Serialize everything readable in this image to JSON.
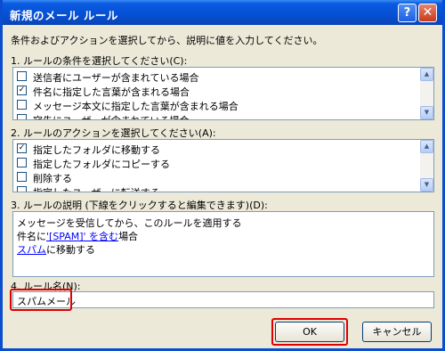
{
  "window": {
    "title": "新規のメール ルール",
    "help_icon": "?",
    "close_icon": "✕"
  },
  "instructions": "条件およびアクションを選択してから、説明に値を入力してください。",
  "step1": {
    "label": "1. ルールの条件を選択してください(C):",
    "items": [
      {
        "text": "送信者にユーザーが含まれている場合",
        "checked": false
      },
      {
        "text": "件名に指定した言葉が含まれる場合",
        "checked": true
      },
      {
        "text": "メッセージ本文に指定した言葉が含まれる場合",
        "checked": false
      },
      {
        "text": "宛先にユーザーが含まれている場合",
        "checked": false
      }
    ]
  },
  "step2": {
    "label": "2. ルールのアクションを選択してください(A):",
    "items": [
      {
        "text": "指定したフォルダに移動する",
        "checked": true
      },
      {
        "text": "指定したフォルダにコピーする",
        "checked": false
      },
      {
        "text": "削除する",
        "checked": false
      },
      {
        "text": "指定したユーザーに転送する",
        "checked": false
      }
    ]
  },
  "step3": {
    "label": "3. ルールの説明 (下線をクリックすると編集できます)(D):",
    "line1": "メッセージを受信してから、このルールを適用する",
    "line2_prefix": "件名に",
    "line2_link1": "'[SPAM]' を含む",
    "line2_suffix": "場合",
    "line3_link": "スパム",
    "line3_suffix": "に移動する"
  },
  "step4": {
    "label": "4. ルール名(N):",
    "value": "スパムメール"
  },
  "buttons": {
    "ok": "OK",
    "cancel": "キャンセル"
  },
  "check_mark": "✓",
  "scroll_up": "▲",
  "scroll_down": "▼"
}
